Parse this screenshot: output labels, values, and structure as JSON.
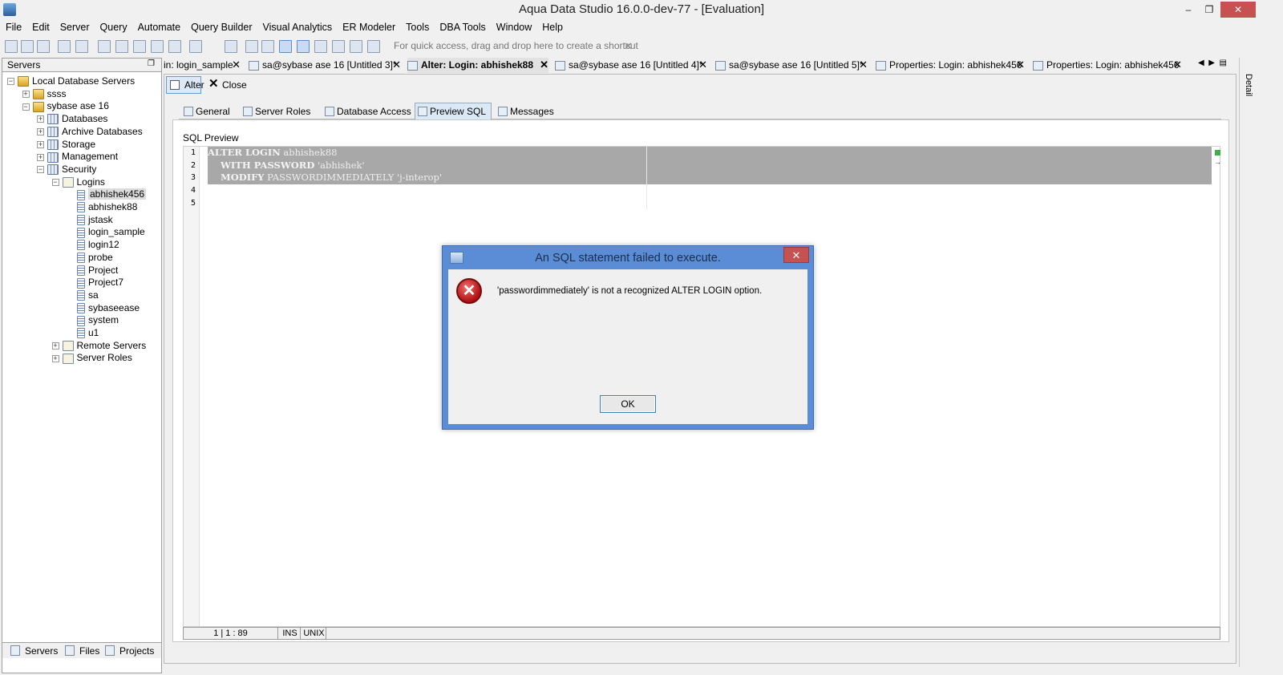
{
  "window": {
    "title": "Aqua Data Studio 16.0.0-dev-77 - [Evaluation]",
    "minimize": "–",
    "restore": "❐",
    "close": "✕"
  },
  "menu": [
    "File",
    "Edit",
    "Server",
    "Query",
    "Automate",
    "Query Builder",
    "Visual Analytics",
    "ER Modeler",
    "Tools",
    "DBA Tools",
    "Window",
    "Help"
  ],
  "toolbar": {
    "hint": "For quick access, drag and drop here to create a shortcut",
    "hint_close": "✕"
  },
  "servers_panel": {
    "title": "Servers",
    "tree": [
      {
        "label": "Local Database Servers",
        "level": 0,
        "expander": "−",
        "icon": "database-group-icon"
      },
      {
        "label": "ssss",
        "level": 1,
        "expander": "+",
        "icon": "server-icon"
      },
      {
        "label": "sybase ase 16",
        "level": 1,
        "expander": "−",
        "icon": "server-icon"
      },
      {
        "label": "Databases",
        "level": 2,
        "expander": "+",
        "icon": "databases-icon"
      },
      {
        "label": "Archive Databases",
        "level": 2,
        "expander": "+",
        "icon": "databases-icon"
      },
      {
        "label": "Storage",
        "level": 2,
        "expander": "+",
        "icon": "storage-icon"
      },
      {
        "label": "Management",
        "level": 2,
        "expander": "+",
        "icon": "management-icon"
      },
      {
        "label": "Security",
        "level": 2,
        "expander": "−",
        "icon": "security-icon"
      },
      {
        "label": "Logins",
        "level": 3,
        "expander": "−",
        "icon": "folder-icon"
      },
      {
        "label": "abhishek456",
        "level": 4,
        "expander": "",
        "icon": "login-icon",
        "selected": true
      },
      {
        "label": "abhishek88",
        "level": 4,
        "expander": "",
        "icon": "login-icon"
      },
      {
        "label": "jstask",
        "level": 4,
        "expander": "",
        "icon": "login-icon"
      },
      {
        "label": "login_sample",
        "level": 4,
        "expander": "",
        "icon": "login-icon"
      },
      {
        "label": "login12",
        "level": 4,
        "expander": "",
        "icon": "login-icon"
      },
      {
        "label": "probe",
        "level": 4,
        "expander": "",
        "icon": "login-icon"
      },
      {
        "label": "Project",
        "level": 4,
        "expander": "",
        "icon": "login-icon"
      },
      {
        "label": "Project7",
        "level": 4,
        "expander": "",
        "icon": "login-icon"
      },
      {
        "label": "sa",
        "level": 4,
        "expander": "",
        "icon": "login-icon"
      },
      {
        "label": "sybaseease",
        "level": 4,
        "expander": "",
        "icon": "login-icon"
      },
      {
        "label": "system",
        "level": 4,
        "expander": "",
        "icon": "login-icon"
      },
      {
        "label": "u1",
        "level": 4,
        "expander": "",
        "icon": "login-icon"
      },
      {
        "label": "Remote Servers",
        "level": 3,
        "expander": "+",
        "icon": "folder-icon"
      },
      {
        "label": "Server Roles",
        "level": 3,
        "expander": "+",
        "icon": "folder-icon"
      }
    ],
    "bottom_tabs": [
      "Servers",
      "Files",
      "Projects"
    ]
  },
  "editor_tabs": [
    {
      "label": "in: login_sample",
      "active": false
    },
    {
      "label": "sa@sybase ase 16 [Untitled 3]*",
      "active": false
    },
    {
      "label": "Alter: Login: abhishek88",
      "active": true
    },
    {
      "label": "sa@sybase ase 16 [Untitled 4]*",
      "active": false
    },
    {
      "label": "sa@sybase ase 16 [Untitled 5]*",
      "active": false
    },
    {
      "label": "Properties: Login: abhishek456",
      "active": false
    },
    {
      "label": "Properties: Login: abhishek456",
      "active": false
    }
  ],
  "details_label": "Detail",
  "actions": {
    "alter": "Alter",
    "close": "Close"
  },
  "sub_tabs": [
    "General",
    "Server Roles",
    "Database Access",
    "Preview SQL",
    "Messages"
  ],
  "active_sub_tab": "Preview SQL",
  "preview": {
    "label": "SQL Preview",
    "line_numbers": [
      "1",
      "2",
      "3",
      "4",
      "5"
    ],
    "lines": [
      {
        "kw": "ALTER LOGIN",
        "rest": " abhishek88"
      },
      {
        "kw": "    WITH PASSWORD",
        "rest": " 'abhishek'"
      },
      {
        "kw": "    MODIFY",
        "rest": " PASSWORDIMMEDIATELY 'j-interop'"
      }
    ]
  },
  "status": {
    "position": "1 | 1 : 89",
    "mode": "INS",
    "line_ending": "UNIX"
  },
  "dialog": {
    "title": "An SQL statement failed to execute.",
    "close": "✕",
    "message": "'passwordimmediately' is not a recognized ALTER LOGIN option.",
    "ok": "OK",
    "error_glyph": "✕"
  },
  "colors": {
    "dialog_frame": "#5b8dd6",
    "close_red": "#c75050",
    "selection_gray": "#a8a8a8"
  }
}
